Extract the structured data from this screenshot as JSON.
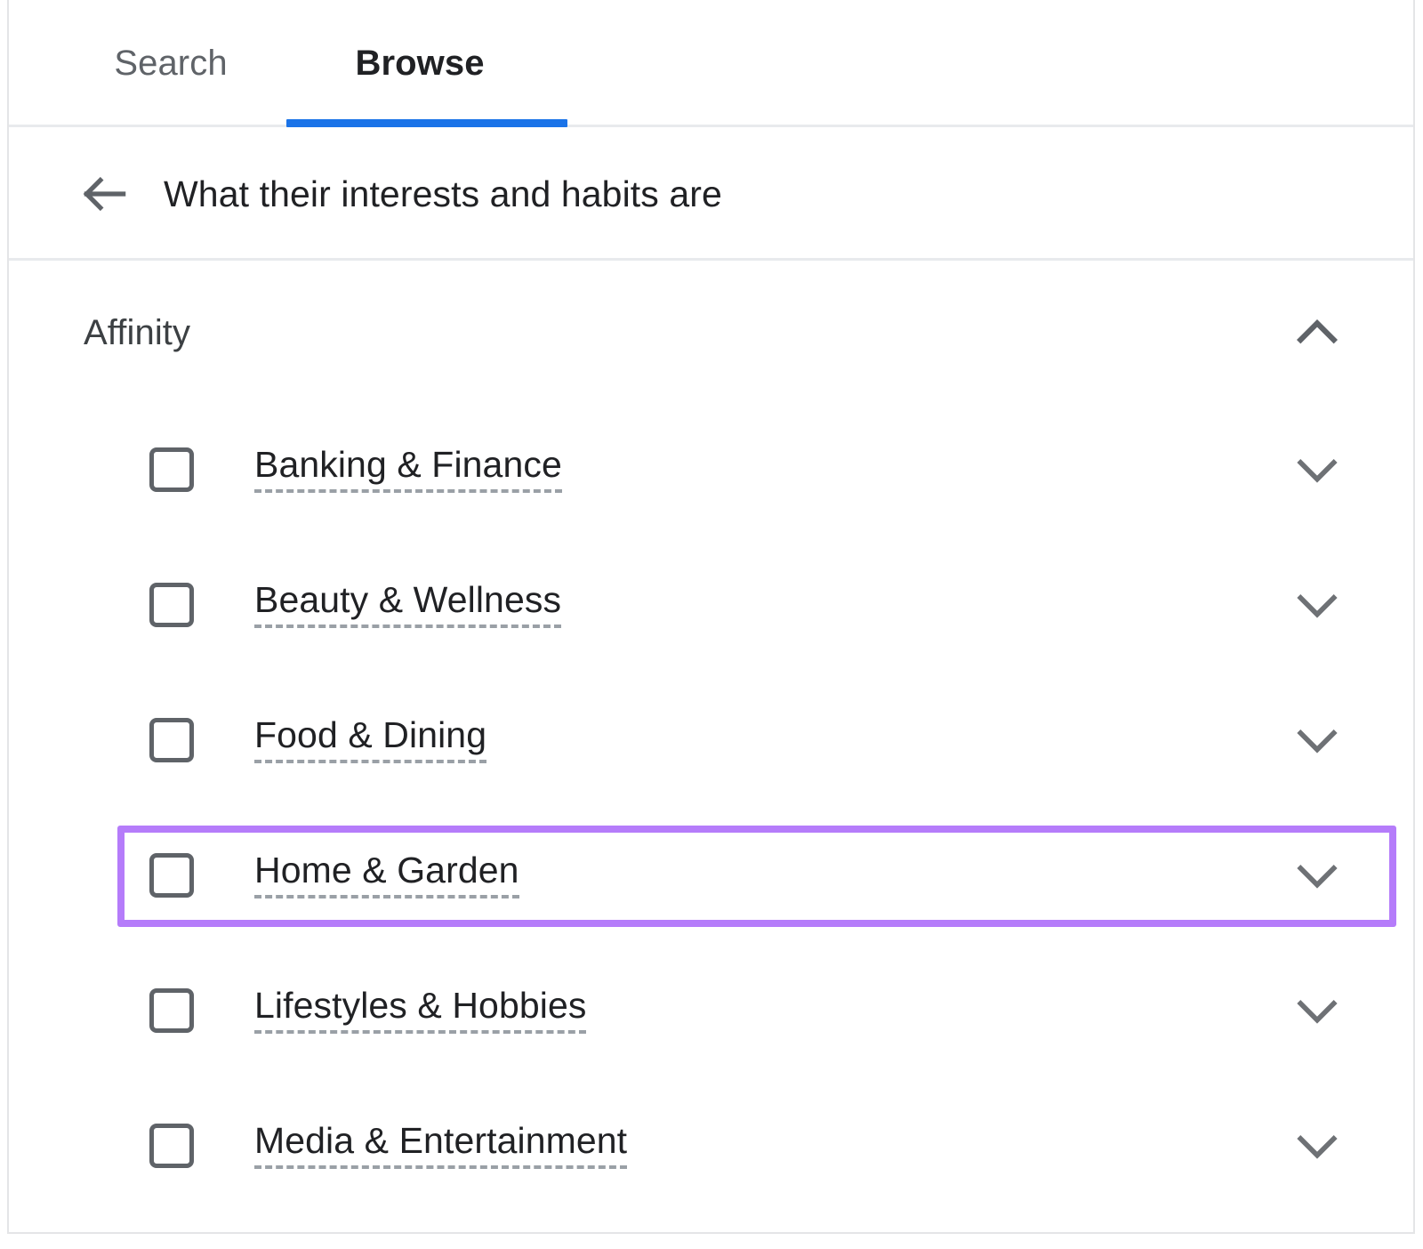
{
  "tabs": [
    {
      "label": "Search",
      "active": false,
      "name": "tab-search"
    },
    {
      "label": "Browse",
      "active": true,
      "name": "tab-browse"
    }
  ],
  "header": {
    "back_icon": "arrow-left-icon",
    "title": "What their interests and habits are"
  },
  "section": {
    "title": "Affinity",
    "expanded": true,
    "toggle_icon": "chevron-up-icon"
  },
  "list": {
    "expand_icon": "chevron-down-icon",
    "items": [
      {
        "label": "Banking & Finance",
        "checked": false
      },
      {
        "label": "Beauty & Wellness",
        "checked": false
      },
      {
        "label": "Food & Dining",
        "checked": false
      },
      {
        "label": "Home & Garden",
        "checked": false
      },
      {
        "label": "Lifestyles & Hobbies",
        "checked": false
      },
      {
        "label": "Media & Entertainment",
        "checked": false
      }
    ]
  },
  "highlight": {
    "target_label": "Home & Garden",
    "color": "#b57cfa"
  },
  "colors": {
    "accent_blue": "#1a73e8",
    "text_primary": "#202124",
    "text_secondary": "#5f6368",
    "divider": "#e8eaed",
    "highlight_purple": "#b57cfa"
  }
}
